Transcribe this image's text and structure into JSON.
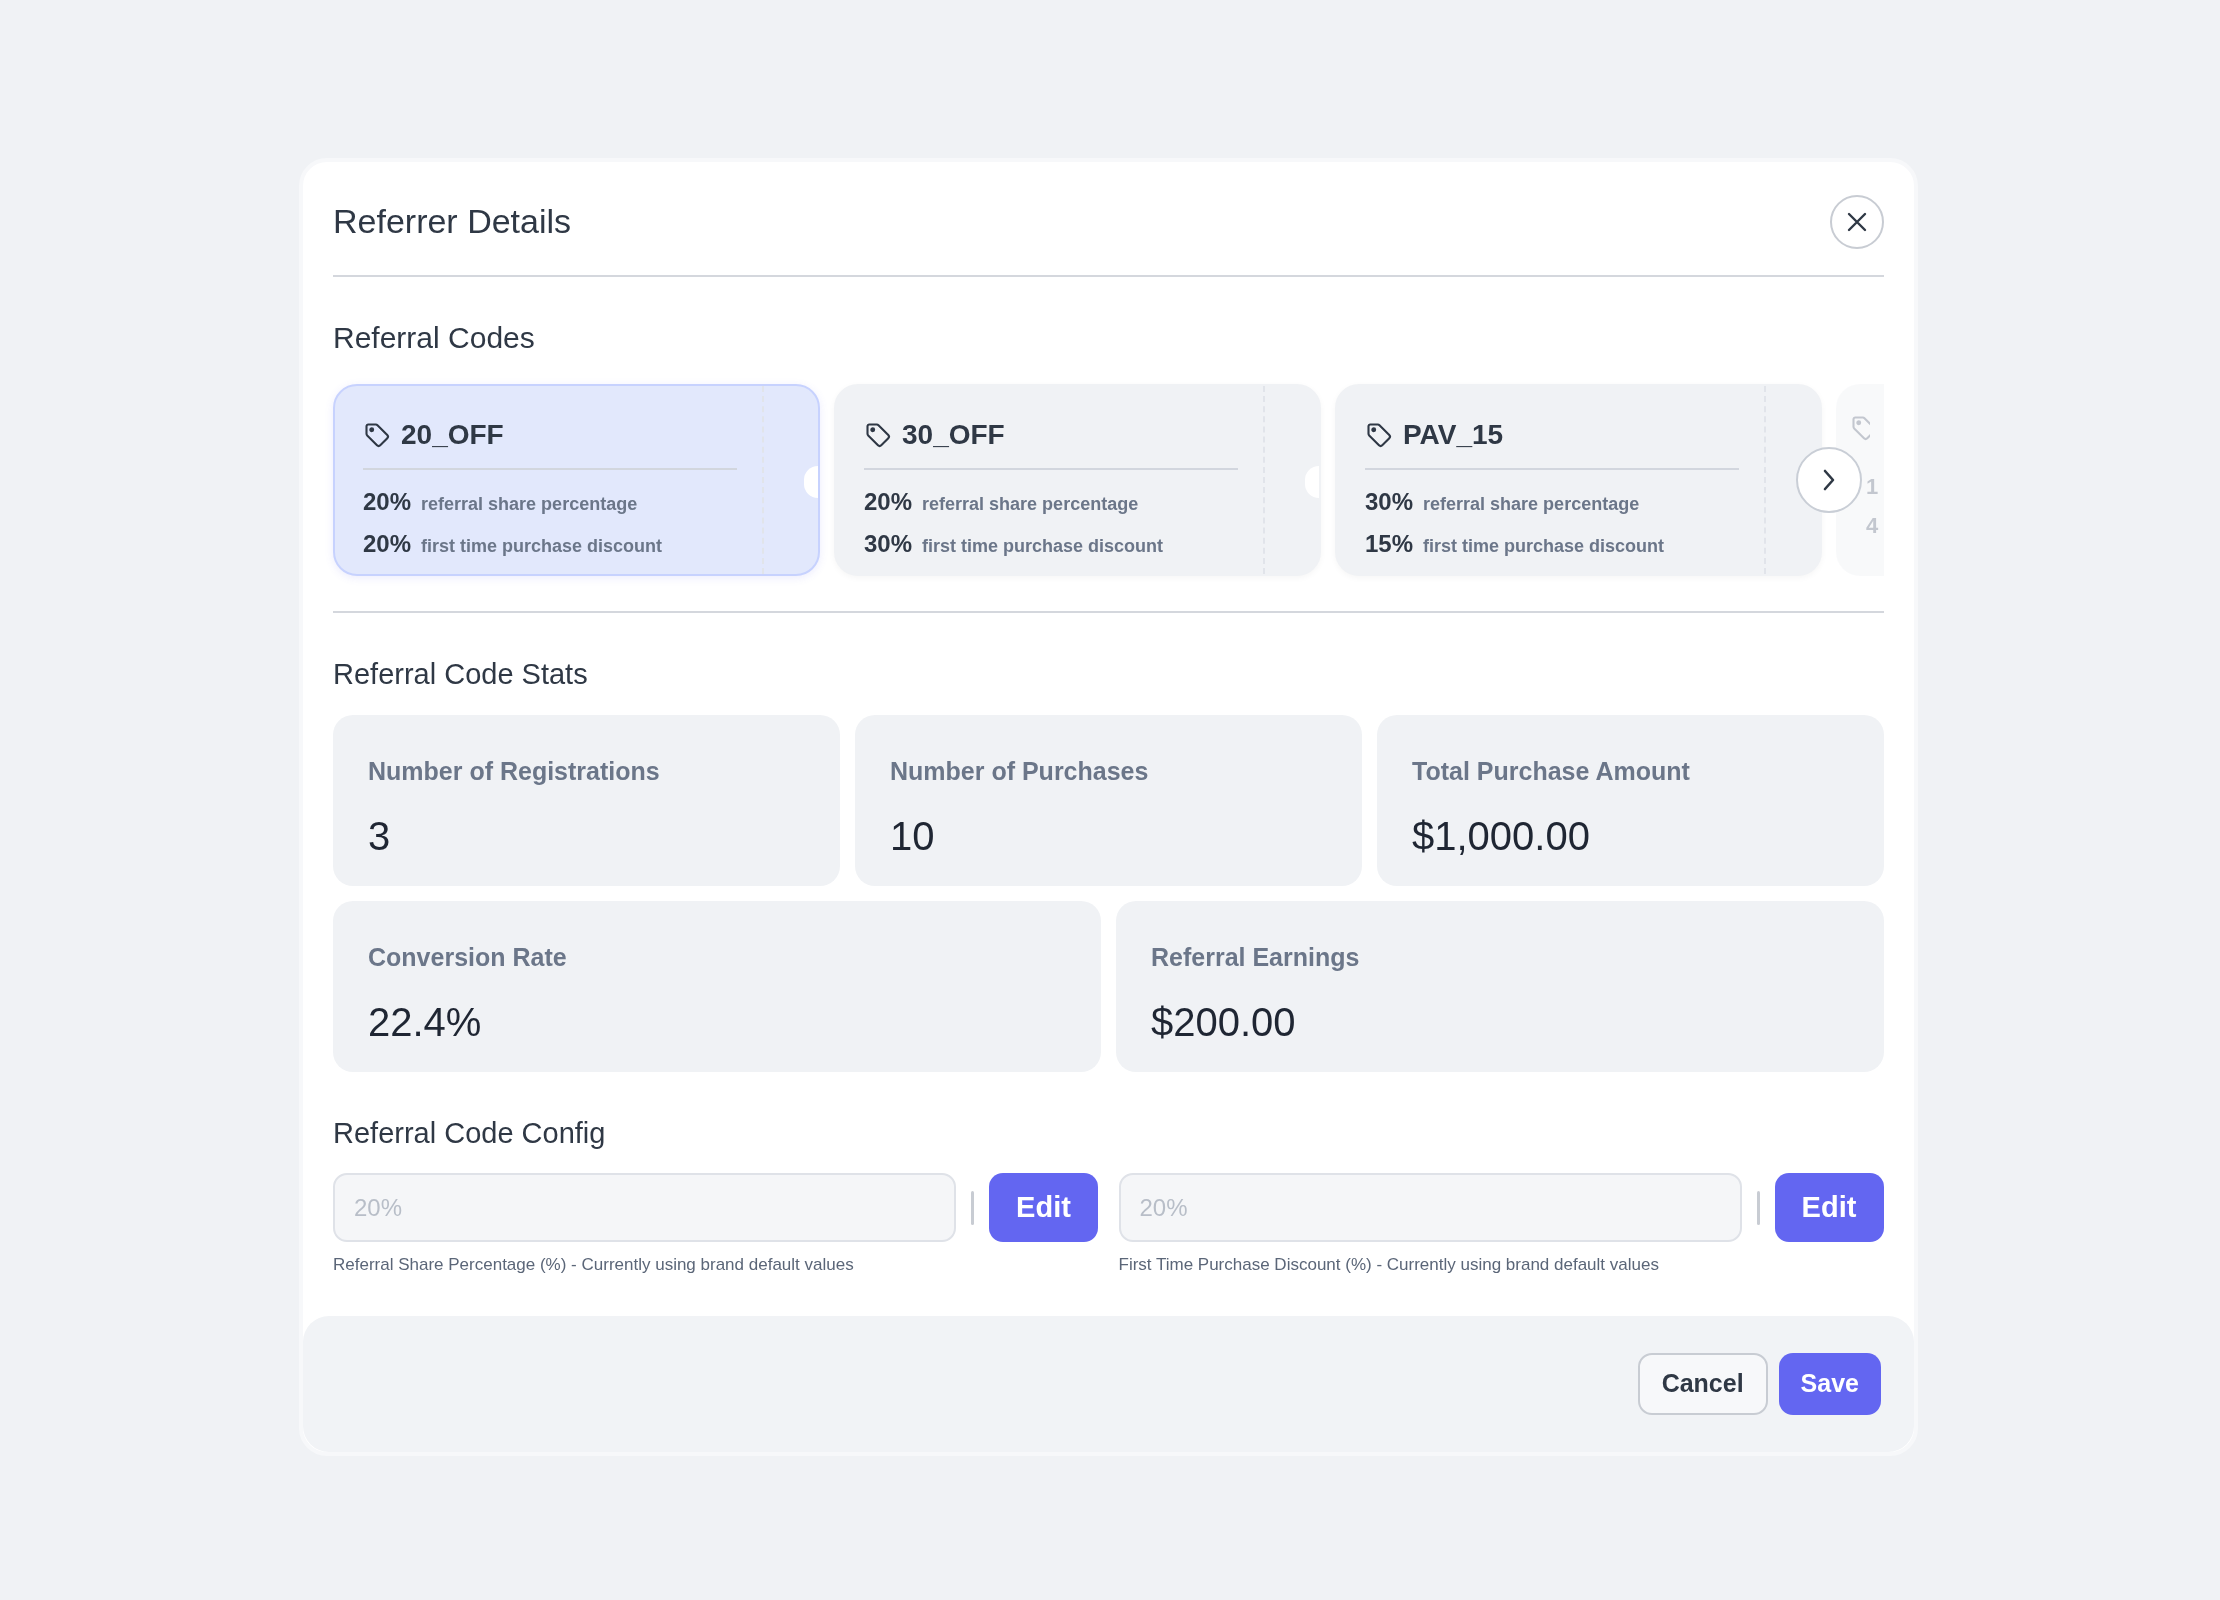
{
  "dialog": {
    "title": "Referrer Details"
  },
  "codes_section": {
    "title": "Referral Codes",
    "codes": [
      {
        "kind": "card",
        "code": "20_OFF",
        "share": "20%",
        "share_label": "referral share percentage",
        "discount": "20%",
        "discount_label": "first time purchase discount",
        "selected": true
      },
      {
        "kind": "card",
        "code": "30_OFF",
        "share": "20%",
        "share_label": "referral share percentage",
        "discount": "30%",
        "discount_label": "first time purchase discount",
        "selected": false
      },
      {
        "kind": "card",
        "code": "PAV_15",
        "share": "30%",
        "share_label": "referral share percentage",
        "discount": "15%",
        "discount_label": "first time purchase discount",
        "selected": false
      },
      {
        "kind": "peek",
        "share": "1",
        "discount": "4"
      }
    ]
  },
  "stats_section": {
    "title": "Referral Code Stats",
    "rows": [
      [
        {
          "label": "Number of Registrations",
          "value": "3"
        },
        {
          "label": "Number of Purchases",
          "value": "10"
        },
        {
          "label": "Total Purchase Amount",
          "value": "$1,000.00"
        }
      ],
      [
        {
          "label": "Conversion Rate",
          "value": "22.4%"
        },
        {
          "label": "Referral Earnings",
          "value": "$200.00"
        }
      ]
    ]
  },
  "config_section": {
    "title": "Referral Code Config",
    "fields": [
      {
        "placeholder": "20%",
        "button": "Edit",
        "help": "Referral Share Percentage (%) - Currently using brand default values"
      },
      {
        "placeholder": "20%",
        "button": "Edit",
        "help": "First Time Purchase Discount (%) - Currently using brand default values"
      }
    ]
  },
  "footer": {
    "cancel": "Cancel",
    "save": "Save"
  }
}
